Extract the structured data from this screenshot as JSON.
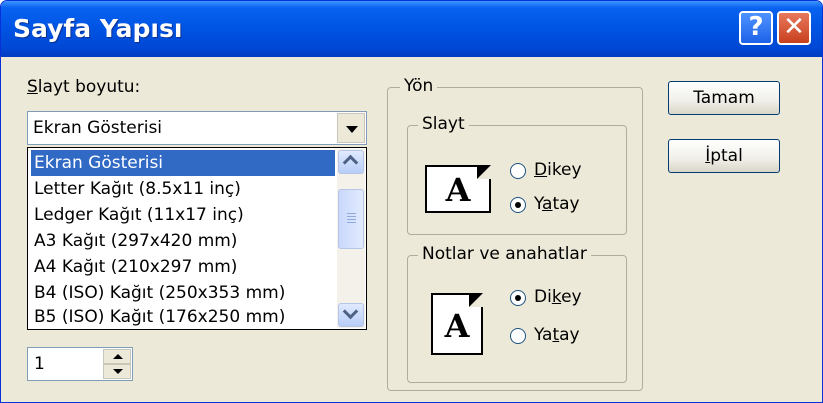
{
  "window": {
    "title": "Sayfa Yapısı",
    "help_symbol": "?",
    "close_symbol": "✕"
  },
  "slide_size": {
    "label_accel": "S",
    "label_rest": "layt boyutu:",
    "selected": "Ekran Gösterisi",
    "options": [
      "Ekran Gösterisi",
      "Letter Kağıt (8.5x11 inç)",
      "Ledger Kağıt (11x17 inç)",
      "A3 Kağıt (297x420 mm)",
      "A4 Kağıt (210x297 mm)",
      "B4 (ISO) Kağıt (250x353 mm)",
      "B5 (ISO) Kağıt (176x250 mm)"
    ]
  },
  "numbering": {
    "value": "1"
  },
  "orientation": {
    "group_label": "Yön",
    "slides": {
      "label": "Slayt",
      "icon_letter": "A",
      "portrait": {
        "accel": "D",
        "rest": "ikey",
        "checked": false
      },
      "landscape": {
        "pre": "Y",
        "accel": "a",
        "rest": "tay",
        "checked": true
      }
    },
    "notes": {
      "label": "Notlar ve anahatlar",
      "icon_letter": "A",
      "portrait": {
        "pre": "Di",
        "accel": "k",
        "rest": "ey",
        "checked": true
      },
      "landscape": {
        "pre": "Ya",
        "accel": "t",
        "rest": "ay",
        "checked": false
      }
    }
  },
  "buttons": {
    "ok": "Tamam",
    "cancel_accel": "İ",
    "cancel_rest": "ptal"
  }
}
